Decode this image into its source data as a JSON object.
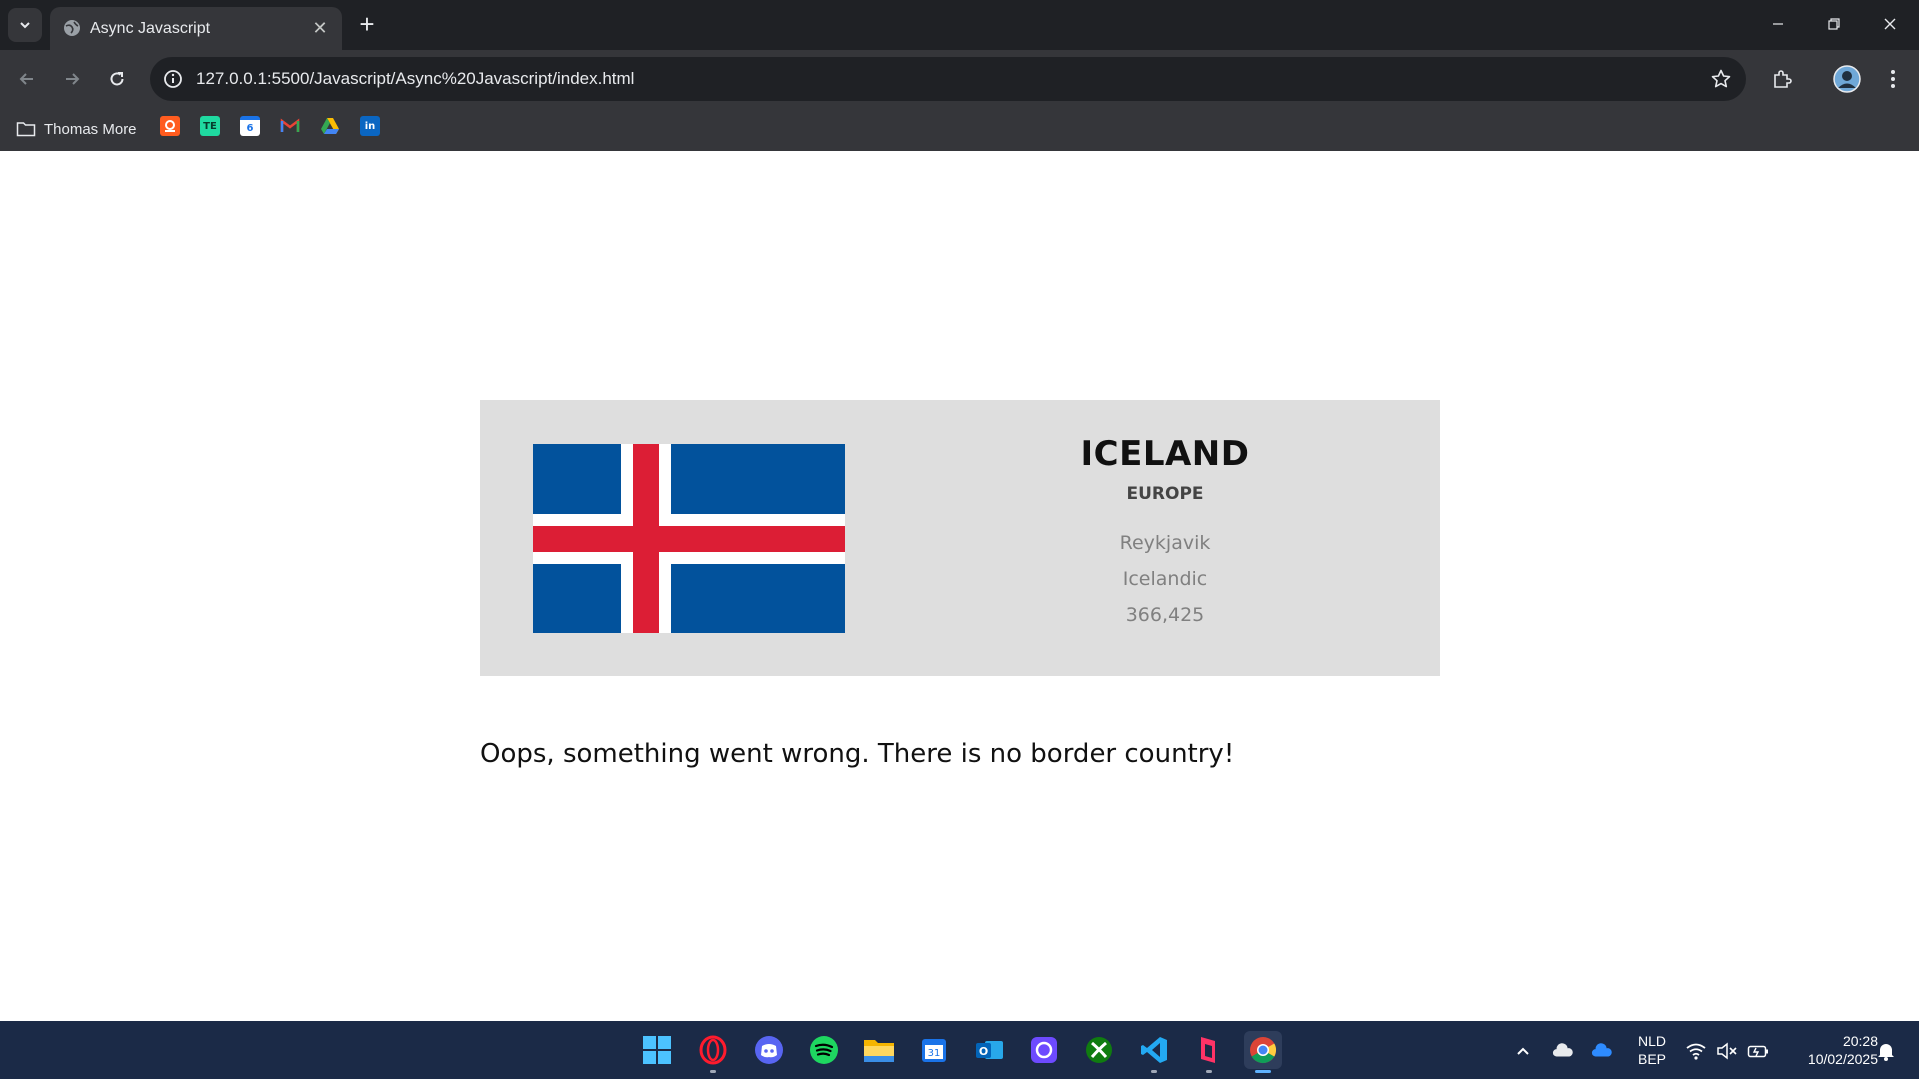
{
  "browser": {
    "tab": {
      "title": "Async Javascript"
    },
    "address_bar": {
      "url": "127.0.0.1:5500/Javascript/Async%20Javascript/index.html"
    },
    "bookmarks": {
      "folder_label": "Thomas More",
      "icons": [
        "orange-bookmark-icon",
        "te-bookmark-icon",
        "google-calendar-bookmark-icon",
        "gmail-bookmark-icon",
        "google-drive-bookmark-icon",
        "linkedin-bookmark-icon"
      ],
      "te_text": "TE",
      "calendar_text": "6",
      "linkedin_text": "in"
    }
  },
  "country": {
    "name": "ICELAND",
    "region": "EUROPE",
    "capital": "Reykjavik",
    "language": "Icelandic",
    "population": "366,425",
    "flag_colors": {
      "blue": "#02529c",
      "white": "#ffffff",
      "red": "#dc1e35"
    }
  },
  "error_message": "Oops, something went wrong. There is no border country!",
  "taskbar": {
    "apps": [
      "windows-start-icon",
      "opera-icon",
      "discord-icon",
      "spotify-icon",
      "file-explorer-icon",
      "calendar-icon",
      "outlook-icon",
      "proton-icon",
      "xbox-icon",
      "vscode-icon",
      "docs-app-icon",
      "chrome-icon"
    ],
    "calendar_day": "31",
    "outlook_letter": "O",
    "language_code": "NLD",
    "keyboard_layout": "BEP",
    "time": "20:28",
    "date": "10/02/2025"
  },
  "colors": {
    "card_background": "#dedede",
    "taskbar_background": "#1b2a47",
    "browser_frame": "#1f2125",
    "toolbar": "#35363a"
  }
}
